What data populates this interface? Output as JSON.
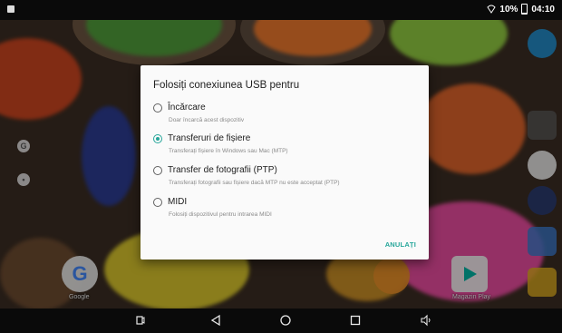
{
  "status_bar": {
    "battery": "10%",
    "time": "04:10"
  },
  "home": {
    "left_app_label": "Google",
    "right_app_label": "Magazin Play"
  },
  "dialog": {
    "title": "Folosiți conexiunea USB pentru",
    "options": [
      {
        "label": "Încărcare",
        "description": "Doar încarcă acest dispozitiv",
        "selected": false
      },
      {
        "label": "Transferuri de fișiere",
        "description": "Transferați fișiere în Windows sau Mac (MTP)",
        "selected": true
      },
      {
        "label": "Transfer de fotografii (PTP)",
        "description": "Transferați fotografii sau fișiere dacă MTP nu este acceptat (PTP)",
        "selected": false
      },
      {
        "label": "MIDI",
        "description": "Folosiți dispozitivul pentru intrarea MIDI",
        "selected": false
      }
    ],
    "cancel_label": "ANULAȚI"
  },
  "colors": {
    "accent": "#26a69a",
    "dialog_bg": "#fafafa"
  },
  "icons": {
    "nav": [
      "screenshot-icon",
      "back-icon",
      "home-icon",
      "recents-icon",
      "volume-icon"
    ]
  }
}
